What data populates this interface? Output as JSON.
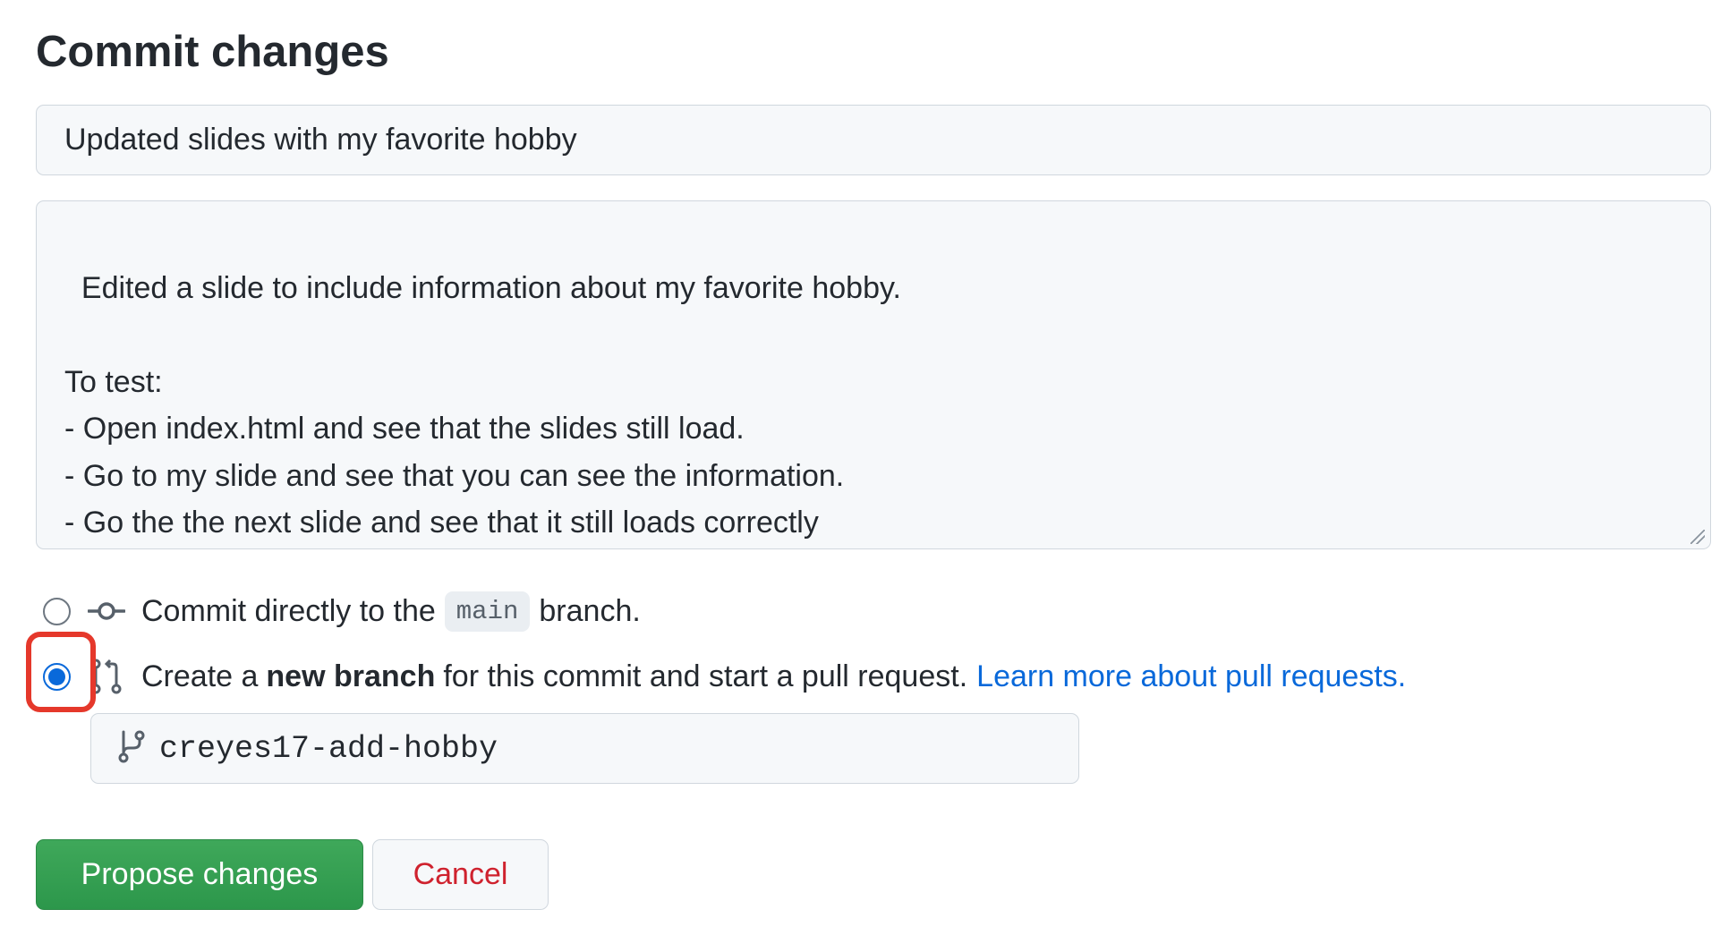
{
  "page": {
    "title": "Commit changes"
  },
  "form": {
    "summary_value": "Updated slides with my favorite hobby",
    "description_value": "Edited a slide to include information about my favorite hobby.\n\nTo test:\n- Open index.html and see that the slides still load.\n- Go to my slide and see that you can see the information.\n- Go the the next slide and see that it still loads correctly"
  },
  "options": {
    "direct": {
      "prefix": "Commit directly to the",
      "branch_code": "main",
      "suffix": "branch.",
      "selected": false,
      "icon": "git-commit-icon"
    },
    "new_branch": {
      "prefix": "Create a",
      "bold": "new branch",
      "suffix": "for this commit and start a pull request.",
      "link": "Learn more about pull requests.",
      "selected": true,
      "icon": "git-pull-request-icon"
    }
  },
  "branch_input": {
    "value": "creyes17-add-hobby",
    "icon": "git-branch-icon"
  },
  "buttons": {
    "propose": "Propose changes",
    "cancel": "Cancel"
  },
  "colors": {
    "primary_button": "#2da44e",
    "link": "#0969da",
    "cancel_text": "#cf222e",
    "highlight": "#e5382b"
  }
}
